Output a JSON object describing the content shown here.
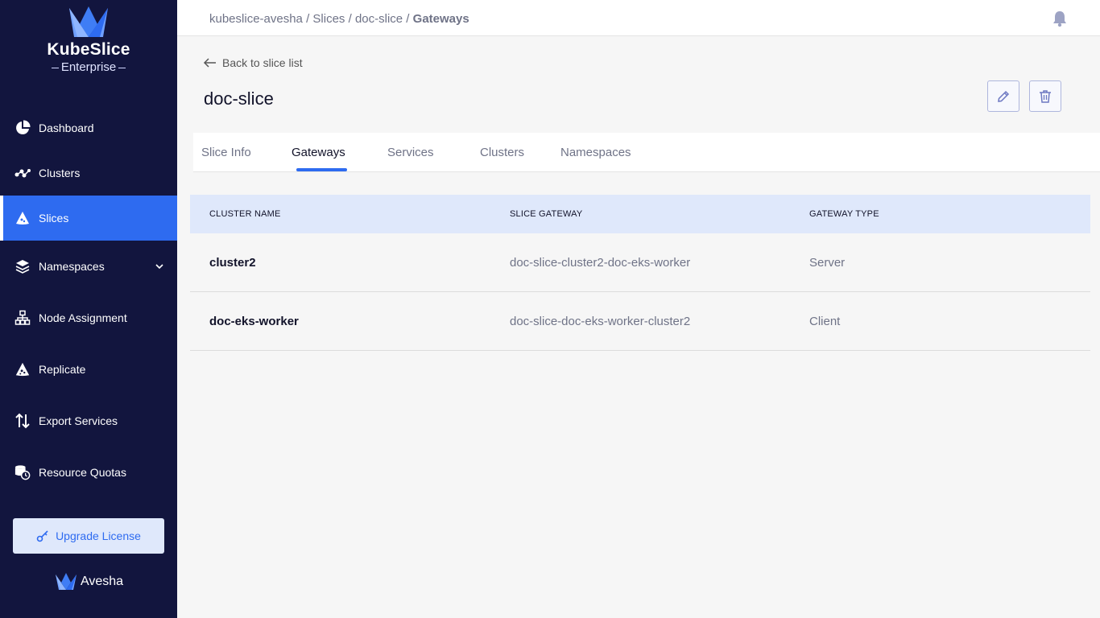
{
  "brand": {
    "title": "KubeSlice",
    "subtitle": "Enterprise",
    "footer": "Avesha"
  },
  "sidebar": {
    "items": [
      {
        "label": "Dashboard",
        "icon": "pie-chart-icon"
      },
      {
        "label": "Clusters",
        "icon": "graph-nodes-icon"
      },
      {
        "label": "Slices",
        "icon": "slice-icon",
        "active": true
      },
      {
        "label": "Namespaces",
        "icon": "layers-icon",
        "expandable": true
      },
      {
        "label": "Node Assignment",
        "icon": "hierarchy-icon"
      },
      {
        "label": "Replicate",
        "icon": "replicate-icon"
      },
      {
        "label": "Export Services",
        "icon": "up-down-arrows-icon"
      },
      {
        "label": "Resource Quotas",
        "icon": "database-clock-icon"
      }
    ],
    "upgrade_label": "Upgrade License"
  },
  "breadcrumb": {
    "parts": [
      "kubeslice-avesha",
      "Slices",
      "doc-slice"
    ],
    "current": "Gateways",
    "separator": " / "
  },
  "back_label": "Back to slice list",
  "page_title": "doc-slice",
  "tabs": [
    {
      "label": "Slice Info"
    },
    {
      "label": "Gateways",
      "active": true
    },
    {
      "label": "Services"
    },
    {
      "label": "Clusters"
    },
    {
      "label": "Namespaces"
    }
  ],
  "table": {
    "headers": [
      "CLUSTER NAME",
      "SLICE GATEWAY",
      "GATEWAY TYPE"
    ],
    "rows": [
      [
        "cluster2",
        "doc-slice-cluster2-doc-eks-worker",
        "Server"
      ],
      [
        "doc-eks-worker",
        "doc-slice-doc-eks-worker-cluster2",
        "Client"
      ]
    ]
  },
  "colors": {
    "sidebar_bg": "#12153e",
    "accent": "#2e6bf0",
    "table_header_bg": "#dfe8fb"
  }
}
